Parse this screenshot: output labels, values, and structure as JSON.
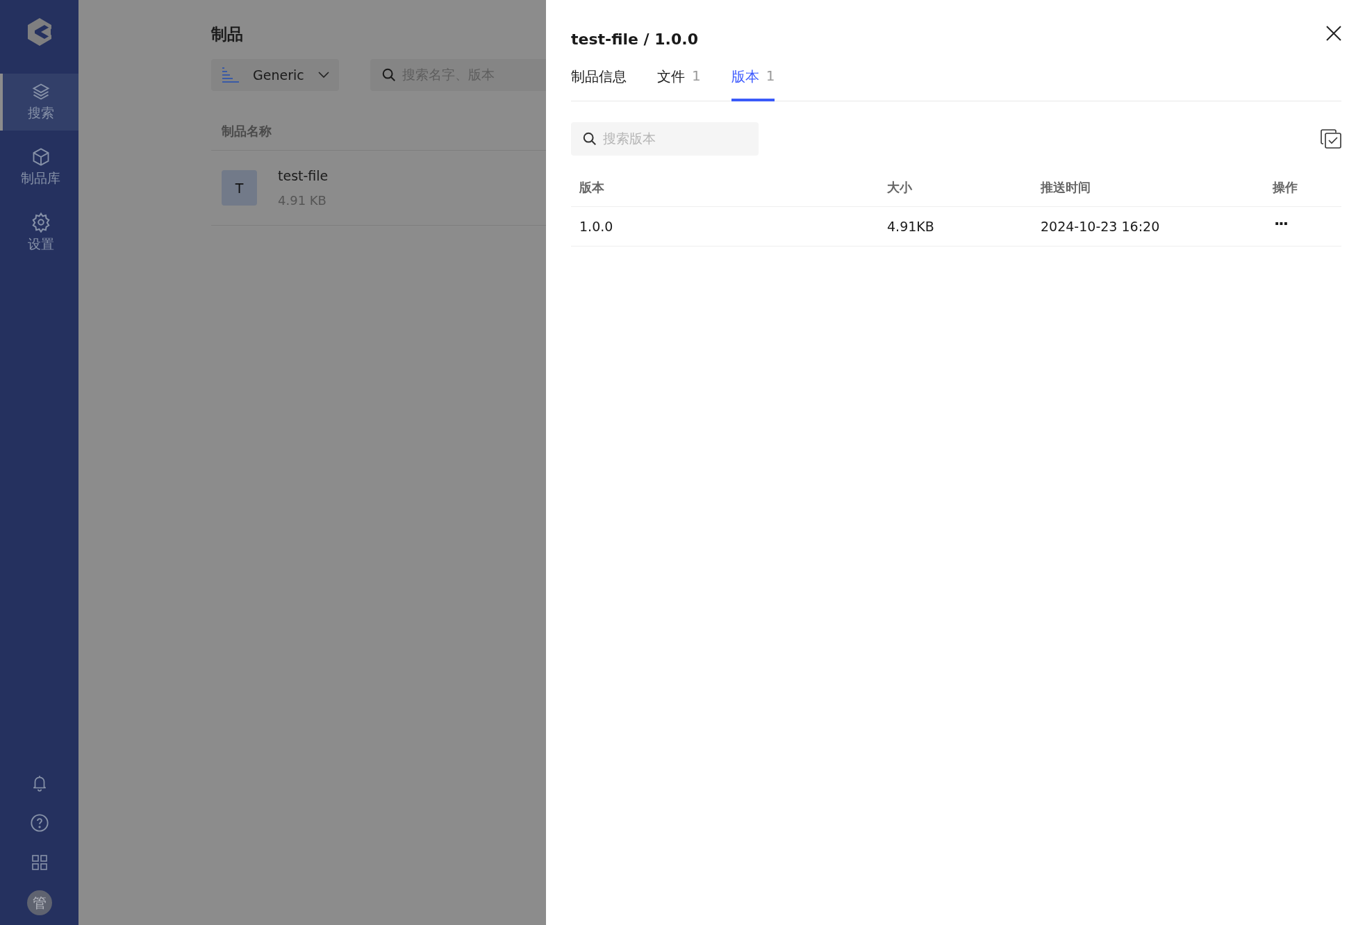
{
  "sidebar": {
    "nav": [
      {
        "label": "搜索",
        "selected": true
      },
      {
        "label": "制品库",
        "selected": false
      },
      {
        "label": "设置",
        "selected": false
      }
    ],
    "avatar": "管"
  },
  "main": {
    "title": "制品",
    "type_select": {
      "value": "Generic"
    },
    "search": {
      "placeholder": "搜索名字、版本"
    },
    "table": {
      "columns": [
        "制品名称"
      ],
      "rows": [
        {
          "initial": "T",
          "name": "test-file",
          "size": "4.91 KB"
        }
      ]
    }
  },
  "drawer": {
    "title": "test-file / 1.0.0",
    "tabs": [
      {
        "label": "制品信息",
        "selected": false
      },
      {
        "label": "文件",
        "count": "1",
        "selected": false
      },
      {
        "label": "版本",
        "count": "1",
        "selected": true
      }
    ],
    "search": {
      "placeholder": "搜索版本"
    },
    "table": {
      "columns": [
        "版本",
        "大小",
        "推送时间",
        "操作"
      ],
      "rows": [
        {
          "cells": [
            "1.0.0",
            "4.91KB",
            "2024-10-23 16:20"
          ],
          "action": "···"
        }
      ]
    }
  }
}
